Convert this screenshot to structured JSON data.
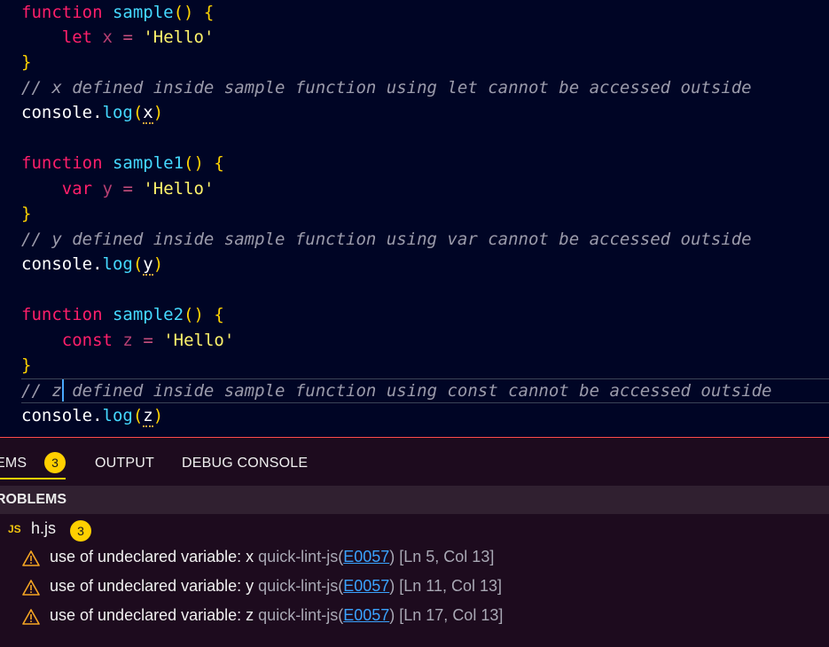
{
  "editor": {
    "lines": {
      "l1": {
        "kw": "function",
        "name": "sample",
        "rest": "() {"
      },
      "l2": {
        "kw": "let",
        "var": "x",
        "op": "=",
        "str": "'Hello'"
      },
      "l3": {
        "brace": "}"
      },
      "l4": {
        "comment": "// x defined inside sample function using let cannot be accessed outside"
      },
      "l5": {
        "obj": "console.",
        "method": "log",
        "open": "(",
        "arg": "x",
        "close": ")"
      },
      "l7": {
        "kw": "function",
        "name": "sample1",
        "rest": "() {"
      },
      "l8": {
        "kw": "var",
        "var": "y",
        "op": "=",
        "str": "'Hello'"
      },
      "l9": {
        "brace": "}"
      },
      "l10": {
        "comment": "// y defined inside sample function using var cannot be accessed outside"
      },
      "l11": {
        "obj": "console.",
        "method": "log",
        "open": "(",
        "arg": "y",
        "close": ")"
      },
      "l13": {
        "kw": "function",
        "name": "sample2",
        "rest": "() {"
      },
      "l14": {
        "kw": "const",
        "var": "z",
        "op": "=",
        "str": "'Hello'"
      },
      "l15": {
        "brace": "}"
      },
      "l16": {
        "comment_a": "// z",
        "comment_b": " defined inside sample function using const cannot be accessed outside"
      },
      "l17": {
        "obj": "console.",
        "method": "log",
        "open": "(",
        "arg": "z",
        "close": ")"
      }
    }
  },
  "panel": {
    "tabs": [
      {
        "label": "EMS",
        "badge": "3"
      },
      {
        "label": "OUTPUT"
      },
      {
        "label": "DEBUG CONSOLE"
      }
    ],
    "section_title": "ROBLEMS",
    "file": {
      "icon": "JS",
      "name": "h.js",
      "count": "3"
    },
    "problems": [
      {
        "icon": "warning-icon",
        "message": "use of undeclared variable: x",
        "source": "quick-lint-js(",
        "code": "E0057",
        "source_end": ")",
        "position": "[Ln 5, Col 13]"
      },
      {
        "icon": "warning-icon",
        "message": "use of undeclared variable: y",
        "source": "quick-lint-js(",
        "code": "E0057",
        "source_end": ")",
        "position": "[Ln 11, Col 13]"
      },
      {
        "icon": "warning-icon",
        "message": "use of undeclared variable: z",
        "source": "quick-lint-js(",
        "code": "E0057",
        "source_end": ")",
        "position": "[Ln 17, Col 13]"
      }
    ]
  },
  "colors": {
    "editor_bg": "#000525",
    "keyword": "#ff1f6a",
    "function_name": "#45d9ff",
    "string": "#fff36b",
    "badge": "#ffd000",
    "link": "#3aa3ff"
  }
}
